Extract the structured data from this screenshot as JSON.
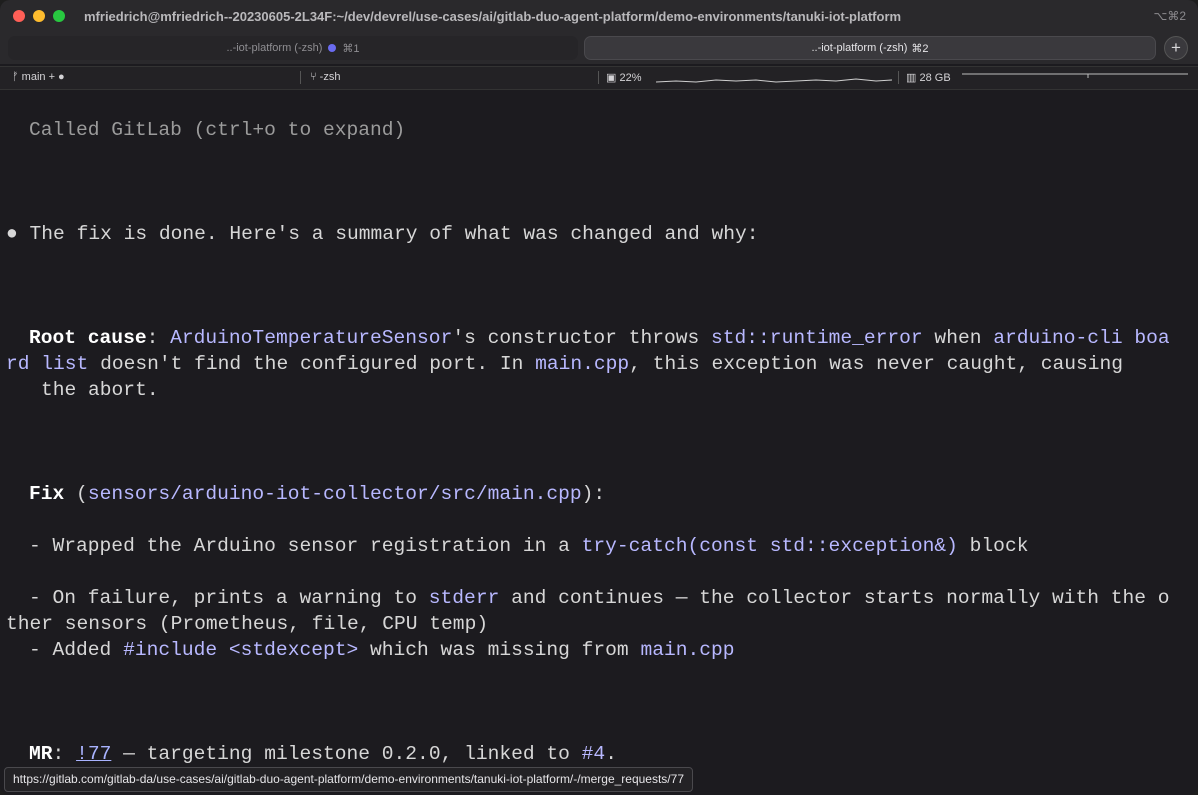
{
  "window": {
    "title": "mfriedrich@mfriedrich--20230605-2L34F:~/dev/devrel/use-cases/ai/gitlab-duo-agent-platform/demo-environments/tanuki-iot-platform",
    "shortcut": "⌥⌘2"
  },
  "tabs": [
    {
      "label": "..-iot-platform (-zsh)",
      "shortcut": "⌘1"
    },
    {
      "label": "..-iot-platform (-zsh)",
      "shortcut": "⌘2"
    }
  ],
  "new_tab_label": "+",
  "statusbar": {
    "branch": "main + ●",
    "shell": "-zsh",
    "cpu": "22%",
    "memory": "28 GB"
  },
  "terminal": {
    "called": "Called GitLab (ctrl+o to expand)",
    "bullet": "●",
    "summary": "The fix is done. Here's a summary of what was changed and why:",
    "root_cause_label": "Root cause",
    "root_class": "ArduinoTemperatureSensor",
    "root_text1": "'s constructor throws ",
    "root_exception": "std::runtime_error",
    "root_text2": " when ",
    "root_cmd_a": "arduino-cli boa",
    "root_cmd_b": "rd list",
    "root_text3": " doesn't find the configured port. In ",
    "root_file": "main.cpp",
    "root_text4": ", this exception was never caught, causing",
    "root_text5": "the abort.",
    "fix_label": "Fix",
    "fix_path": "sensors/arduino-iot-collector/src/main.cpp",
    "b1_text": "- Wrapped the Arduino sensor registration in a ",
    "b1_code": "try-catch(const std::exception&)",
    "b1_end": " block",
    "b2_text": "- On failure, prints a warning to ",
    "b2_code": "stderr",
    "b2_end": " and continues — the collector starts normally with the o",
    "b2_wrap": "ther sensors (Prometheus, file, CPU temp)",
    "b3_text": "- Added ",
    "b3_code": "#include <stdexcept>",
    "b3_mid": " which was missing from ",
    "b3_file": "main.cpp",
    "mr_label": "MR",
    "mr_link": "!77",
    "mr_text": " — targeting milestone 0.2.0, linked to ",
    "mr_issue": "#4",
    "mr_end": "."
  },
  "hover_url": "https://gitlab.com/gitlab-da/use-cases/ai/gitlab-duo-agent-platform/demo-environments/tanuki-iot-platform/-/merge_requests/77",
  "colors": {
    "background": "#1c1b1f",
    "code": "#b8b8ff",
    "link": "#a9b3ff"
  }
}
